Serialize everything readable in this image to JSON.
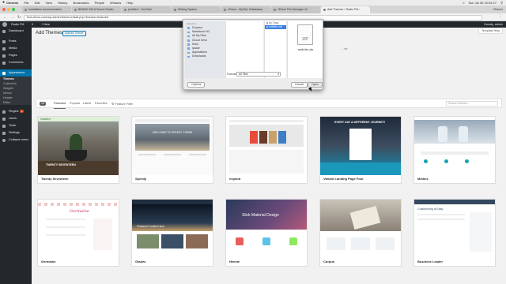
{
  "menubar": {
    "apple": "",
    "items": [
      "Chrome",
      "File",
      "Edit",
      "View",
      "History",
      "Bookmarks",
      "People",
      "Window",
      "Help"
    ],
    "clock": "Sun Jul 30  10:04:27"
  },
  "tabs": [
    {
      "label": "Installation documentation"
    },
    {
      "label": "BRAND ON A Sound Studio"
    },
    {
      "label": "(untitled - YouTube"
    },
    {
      "label": "Writing System"
    },
    {
      "label": "cPanel - MySQL Databases"
    },
    {
      "label": "cPanel File Manager v3"
    },
    {
      "label": "Add Themes ‹ Radio FM ›",
      "active": true
    }
  ],
  "profile": "Ruben",
  "address": {
    "url": "test-demo.com/wp-admin/theme-install.php?browse=featured"
  },
  "adminbar": {
    "site": "Radio FM",
    "count": "0",
    "new": "+ New",
    "howdy": "Howdy, admin"
  },
  "sidebar": {
    "items": [
      {
        "label": "Dashboard"
      },
      {
        "label": "Posts"
      },
      {
        "label": "Media"
      },
      {
        "label": "Pages"
      },
      {
        "label": "Comments"
      },
      {
        "label": "Appearance",
        "active": true
      }
    ],
    "submenu": [
      {
        "label": "Themes",
        "current": true
      },
      {
        "label": "Customize"
      },
      {
        "label": "Widgets"
      },
      {
        "label": "Menus"
      },
      {
        "label": "Header"
      },
      {
        "label": "Editor"
      }
    ],
    "items2": [
      {
        "label": "Plugins",
        "badge": "1"
      },
      {
        "label": "Users"
      },
      {
        "label": "Tools"
      },
      {
        "label": "Settings"
      },
      {
        "label": "Collapse menu"
      }
    ]
  },
  "main": {
    "title": "Add Themes",
    "upload_button": "Upload Theme",
    "help": "Template Help",
    "notice": "...es."
  },
  "filter": {
    "count": "15",
    "tabs": [
      "Featured",
      "Popular",
      "Latest",
      "Favorites"
    ],
    "feature_filter": "Feature Filter",
    "search_placeholder": "Search themes..."
  },
  "themes": [
    {
      "name": "Twenty Seventeen",
      "installed": "Installed",
      "shot_text": "TWENTY SEVENTEEN"
    },
    {
      "name": "Speedy",
      "shot_text": "WELCOME TO SPEEDY THEME"
    },
    {
      "name": "explora"
    },
    {
      "name": "Variant Landing Page Four",
      "shot_text": "EVERY DAY A DIFFERENT JOURNEY!"
    },
    {
      "name": "Medics"
    },
    {
      "name": "Germaine",
      "shot_text": "Germaine"
    },
    {
      "name": "Glades",
      "shot_text": "Featured Content Here"
    },
    {
      "name": "Heeste",
      "shot_text": "Slick Material Design"
    },
    {
      "name": "Corpus"
    },
    {
      "name": "Business Leader",
      "shot_text": "Customizing is Easy"
    }
  ],
  "dialog": {
    "sidebar_header": "Favorites",
    "sidebar_items": [
      "Dropbox",
      "Macintosh HD",
      "All My Files",
      "iCloud Drive",
      "Ikran",
      "ipaadr",
      "Applications",
      "Downloads"
    ],
    "col1": [],
    "col2": [
      {
        "label": "No Tags",
        "selected": false
      },
      {
        "label": "radiofm.zip",
        "selected": true
      }
    ],
    "preview_badge": "ZIP",
    "preview_name": "radiofm.zip",
    "format_label": "Format:",
    "format_value": "All Files",
    "options_button": "Options",
    "cancel_button": "Cancel",
    "open_button": "Open"
  },
  "colors": {
    "wp_dark": "#23282d",
    "wp_blue": "#0073aa",
    "mac_select": "#3a7ee3"
  }
}
